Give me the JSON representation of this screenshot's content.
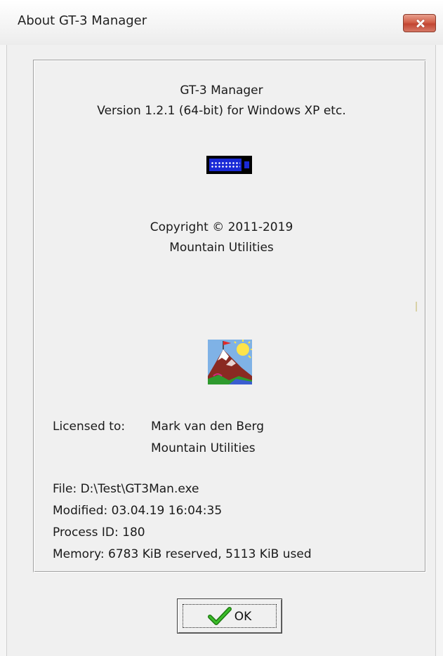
{
  "window": {
    "title": "About GT-3 Manager",
    "close_icon": "close-icon"
  },
  "about": {
    "app_name": "GT-3 Manager",
    "version": "Version 1.2.1 (64-bit) for Windows XP etc.",
    "copyright": "Copyright © 2011-2019",
    "company": "Mountain Utilities",
    "device_icon": "gt3-device-icon",
    "logo_icon": "mountain-logo-icon"
  },
  "license": {
    "label": "Licensed to:",
    "name": "Mark van den Berg",
    "company": "Mountain Utilities"
  },
  "info": {
    "file": "File: D:\\Test\\GT3Man.exe",
    "modified": "Modified: 03.04.19 16:04:35",
    "process_id": "Process ID: 180",
    "memory": "Memory: 6783 KiB reserved, 5113 KiB used"
  },
  "buttons": {
    "ok_label": "OK",
    "ok_icon": "checkmark-icon"
  },
  "colors": {
    "close_button": "#c8503c",
    "device_screen": "#1a2ad6",
    "checkmark": "#2e9a1e"
  }
}
